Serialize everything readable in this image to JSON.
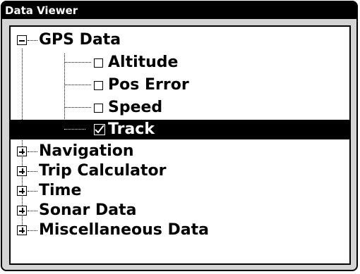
{
  "window": {
    "title": "Data Viewer"
  },
  "tree": {
    "items": [
      {
        "label": "GPS Data",
        "expanded": true,
        "children": [
          {
            "label": "Altitude",
            "checked": false
          },
          {
            "label": "Pos Error",
            "checked": false
          },
          {
            "label": "Speed",
            "checked": false
          },
          {
            "label": "Track",
            "checked": true,
            "selected": true
          }
        ]
      },
      {
        "label": "Navigation",
        "expanded": false
      },
      {
        "label": "Trip Calculator",
        "expanded": false
      },
      {
        "label": "Time",
        "expanded": false
      },
      {
        "label": "Sonar Data",
        "expanded": false
      },
      {
        "label": "Miscellaneous Data",
        "expanded": false
      }
    ]
  }
}
